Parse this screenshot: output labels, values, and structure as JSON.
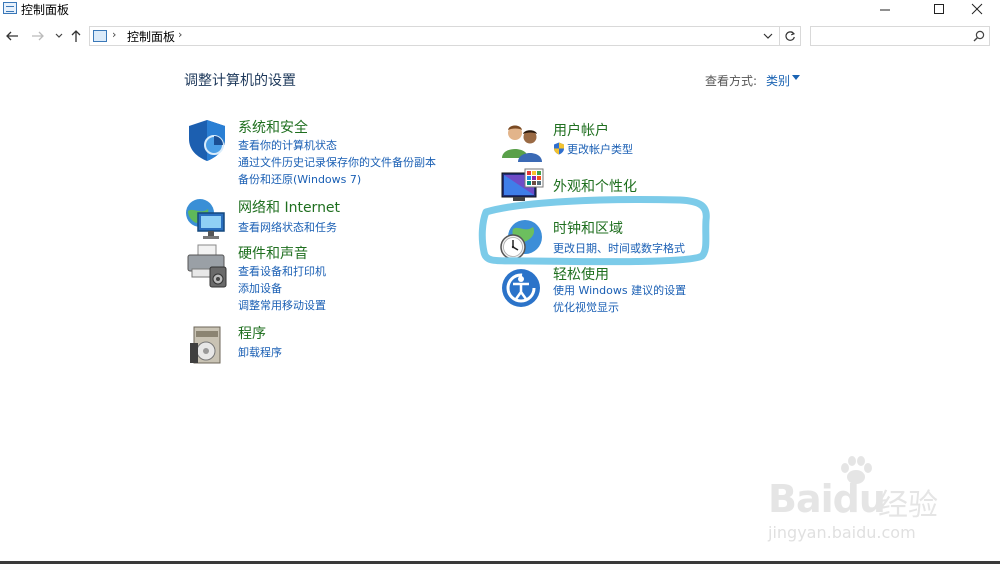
{
  "window": {
    "title": "控制面板",
    "minimize_icon": "minimize-icon",
    "maximize_icon": "maximize-icon",
    "close_icon": "close-icon"
  },
  "nav": {
    "address_path": "控制面板",
    "separator": "›",
    "search_placeholder": ""
  },
  "main": {
    "heading": "调整计算机的设置",
    "view_by_label": "查看方式:",
    "view_by_value": "类别"
  },
  "categories": [
    {
      "title": "系统和安全",
      "icon": "shield-icon",
      "links": [
        "查看你的计算机状态",
        "通过文件历史记录保存你的文件备份副本",
        "备份和还原(Windows 7)"
      ]
    },
    {
      "title": "网络和 Internet",
      "icon": "network-globe-icon",
      "links": [
        "查看网络状态和任务"
      ]
    },
    {
      "title": "硬件和声音",
      "icon": "printer-icon",
      "links": [
        "查看设备和打印机",
        "添加设备",
        "调整常用移动设置"
      ]
    },
    {
      "title": "程序",
      "icon": "programs-icon",
      "links": [
        "卸载程序"
      ]
    },
    {
      "title": "用户帐户",
      "icon": "users-icon",
      "links": [
        "更改帐户类型"
      ]
    },
    {
      "title": "外观和个性化",
      "icon": "appearance-icon",
      "links": []
    },
    {
      "title": "时钟和区域",
      "icon": "clock-globe-icon",
      "links": [
        "更改日期、时间或数字格式"
      ]
    },
    {
      "title": "轻松使用",
      "icon": "ease-of-access-icon",
      "links": [
        "使用 Windows 建议的设置",
        "优化视觉显示"
      ]
    }
  ],
  "watermark": {
    "brand": "Bai",
    "brand2": "du",
    "cn": "经验",
    "url": "jingyan.baidu.com"
  },
  "colors": {
    "link": "#1a5fb4",
    "category_title": "#1f6f1f",
    "highlight_marker": "#7ccbe9"
  }
}
